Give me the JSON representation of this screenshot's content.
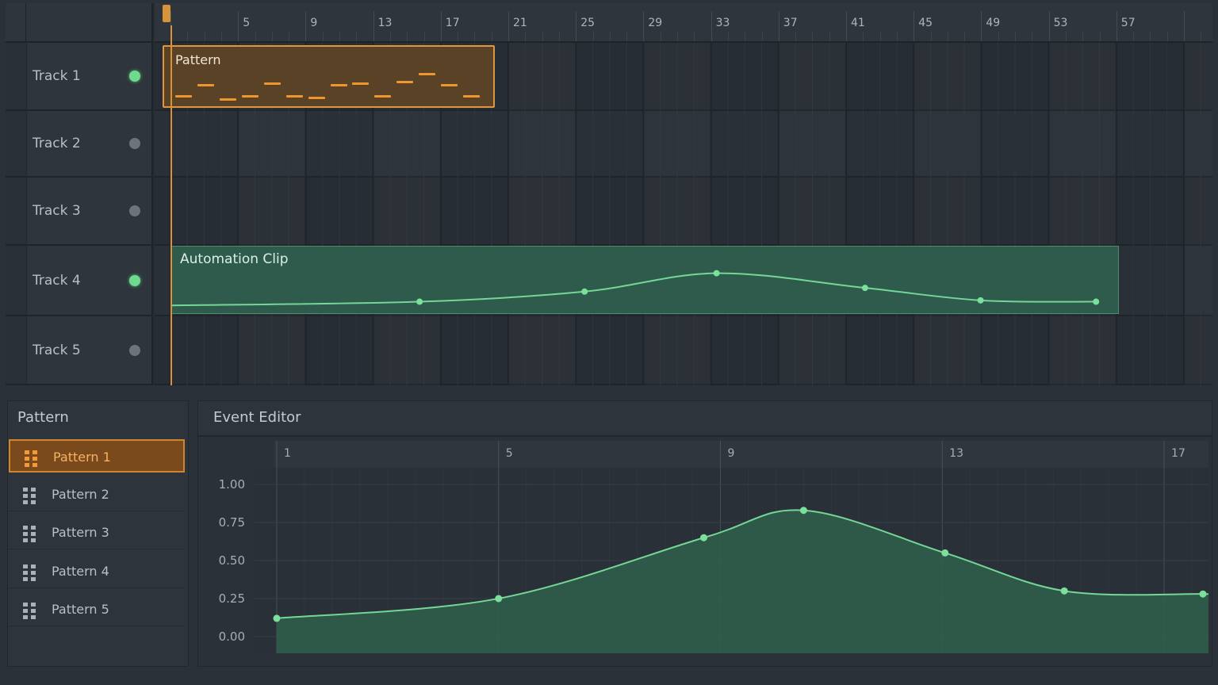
{
  "ruler": {
    "labels": [
      "5",
      "9",
      "13",
      "17",
      "21",
      "25",
      "29",
      "33",
      "37",
      "41",
      "45",
      "49",
      "53",
      "57"
    ],
    "first_bar": 1,
    "last_bar": 63
  },
  "tracks": [
    {
      "label": "Track 1",
      "active": true
    },
    {
      "label": "Track 2",
      "active": false
    },
    {
      "label": "Track 3",
      "active": false
    },
    {
      "label": "Track 4",
      "active": true
    },
    {
      "label": "Track 5",
      "active": false
    }
  ],
  "pattern_clip": {
    "title": "Pattern",
    "track": 1,
    "start_bar": 1,
    "end_bar": 21,
    "note_levels": [
      0.2,
      0.55,
      0.1,
      0.2,
      0.6,
      0.2,
      0.15,
      0.55,
      0.6,
      0.2,
      0.65,
      0.9,
      0.55,
      0.2
    ]
  },
  "automation_clip": {
    "title": "Automation Clip",
    "track": 4,
    "start_bar": 1,
    "end_bar": 58,
    "points": [
      [
        1,
        0.1
      ],
      [
        16,
        0.18
      ],
      [
        26,
        0.4
      ],
      [
        34,
        0.8
      ],
      [
        43,
        0.48
      ],
      [
        50,
        0.21
      ],
      [
        57,
        0.18
      ]
    ]
  },
  "pattern_panel": {
    "title": "Pattern",
    "items": [
      {
        "label": "Pattern 1",
        "selected": true
      },
      {
        "label": "Pattern 2",
        "selected": false
      },
      {
        "label": "Pattern 3",
        "selected": false
      },
      {
        "label": "Pattern 4",
        "selected": false
      },
      {
        "label": "Pattern 5",
        "selected": false
      }
    ]
  },
  "event_editor": {
    "title": "Event Editor",
    "chart_data": {
      "type": "area",
      "x_tick_labels": [
        "1",
        "5",
        "9",
        "13",
        "17"
      ],
      "y_tick_labels": [
        "1.00",
        "0.75",
        "0.50",
        "0.25",
        "0.00"
      ],
      "xlim": [
        0.6,
        17.8
      ],
      "ylim": [
        -0.11,
        1.11
      ],
      "grid": true,
      "series": [
        {
          "points": [
            [
              1,
              0.12
            ],
            [
              5,
              0.25
            ],
            [
              8.7,
              0.65
            ],
            [
              10.5,
              0.83
            ],
            [
              13.05,
              0.55
            ],
            [
              15.2,
              0.3
            ],
            [
              17.7,
              0.28
            ]
          ]
        }
      ]
    }
  },
  "colors": {
    "accent_orange": "#e0963e",
    "automation_green": "#6fd98f",
    "automation_fill": "#2f5b4c",
    "panel_bg": "#2e343b",
    "grid_bg": "#262c33"
  }
}
